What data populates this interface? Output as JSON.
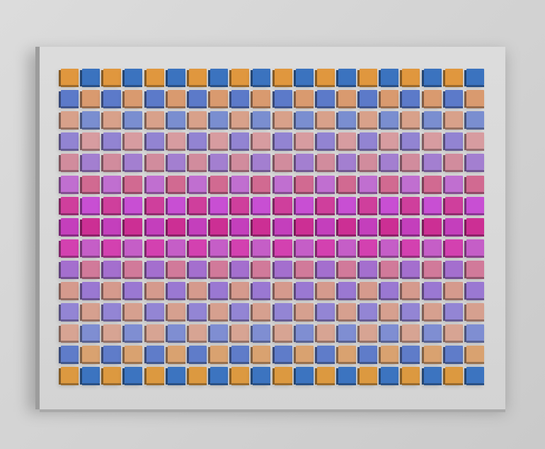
{
  "artwork": {
    "columns": 20,
    "rows": 15,
    "palette": {
      "row_colors_a": [
        "#e0973e",
        "#d99a6f",
        "#d8a18a",
        "#d79ca0",
        "#d18c9d",
        "#d16a91",
        "#cf3f9c",
        "#cc2f94",
        "#d341b0",
        "#d17a9a",
        "#d59a8d",
        "#d6a08f",
        "#d7a493",
        "#d9a270",
        "#dc9940"
      ],
      "row_colors_b": [
        "#3b73bf",
        "#5c7ac9",
        "#7a8ed0",
        "#9284d2",
        "#a37fd0",
        "#c06fd0",
        "#c84fd3",
        "#c43fbc",
        "#c55ec7",
        "#a46fce",
        "#9a78d2",
        "#9385d4",
        "#7f8ed2",
        "#5f7cc9",
        "#3c74c0"
      ]
    }
  }
}
